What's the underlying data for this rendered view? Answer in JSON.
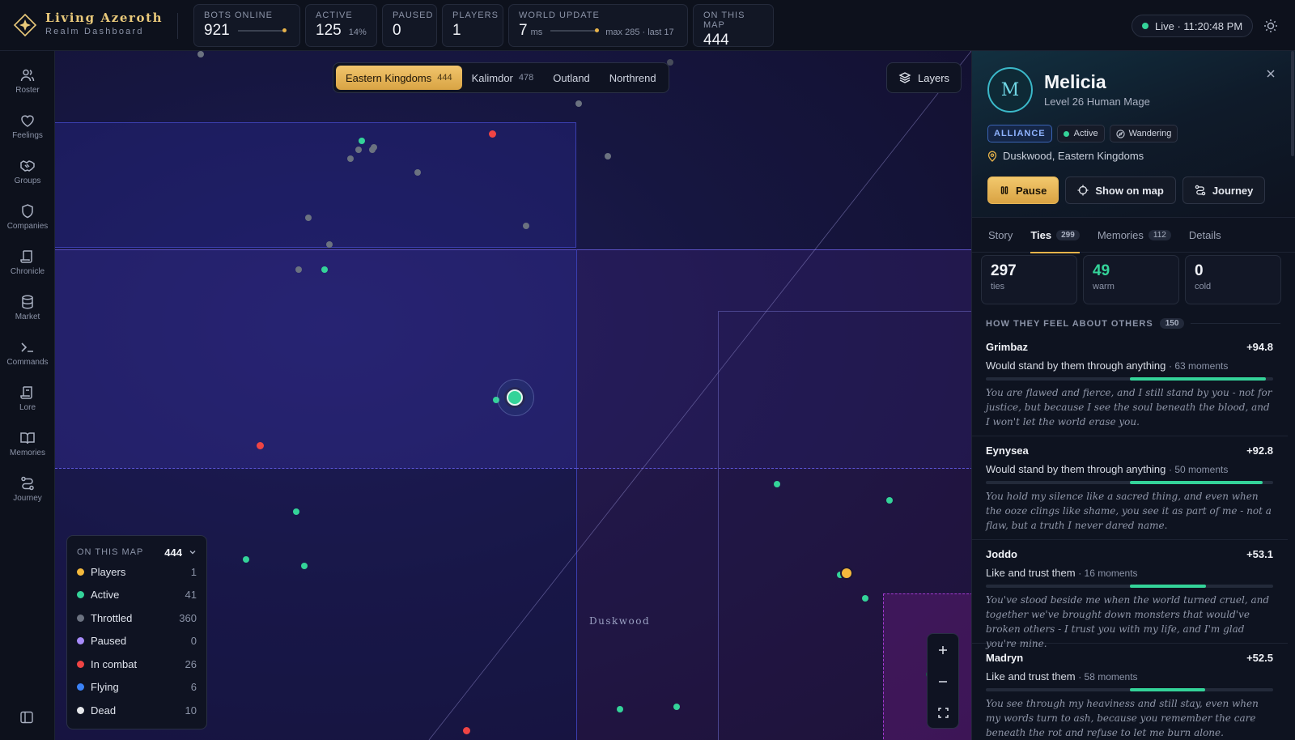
{
  "brand": {
    "name": "Living Azeroth",
    "subtitle": "Realm Dashboard"
  },
  "stats": {
    "bots_online": {
      "label": "BOTS ONLINE",
      "value": "921"
    },
    "active": {
      "label": "ACTIVE",
      "value": "125",
      "percent": "14%"
    },
    "paused": {
      "label": "PAUSED",
      "value": "0"
    },
    "players": {
      "label": "PLAYERS",
      "value": "1"
    },
    "world_update": {
      "label": "WORLD UPDATE",
      "value": "7",
      "unit": "ms",
      "note": "max 285 · last 17"
    },
    "on_this_map": {
      "label": "ON THIS MAP",
      "value": "444"
    }
  },
  "live": {
    "text": "Live · 11:20:48 PM",
    "color": "#34d399"
  },
  "rail": [
    {
      "label": "Roster",
      "icon": "users-icon"
    },
    {
      "label": "Feelings",
      "icon": "heart-icon"
    },
    {
      "label": "Groups",
      "icon": "handshake-icon"
    },
    {
      "label": "Companies",
      "icon": "shield-icon"
    },
    {
      "label": "Chronicle",
      "icon": "scroll-icon"
    },
    {
      "label": "Market",
      "icon": "database-icon"
    },
    {
      "label": "Commands",
      "icon": "terminal-icon"
    },
    {
      "label": "Lore",
      "icon": "book-scroll-icon"
    },
    {
      "label": "Memories",
      "icon": "open-book-icon"
    },
    {
      "label": "Journey",
      "icon": "route-icon"
    }
  ],
  "map": {
    "continent_tabs": [
      {
        "label": "Eastern Kingdoms",
        "count": "444",
        "active": true
      },
      {
        "label": "Kalimdor",
        "count": "478",
        "active": false
      },
      {
        "label": "Outland",
        "count": "",
        "active": false
      },
      {
        "label": "Northrend",
        "count": "",
        "active": false
      }
    ],
    "layers_label": "Layers",
    "zone_label": "Duskwood",
    "legend": {
      "title": "ON THIS MAP",
      "total": "444",
      "rows": [
        {
          "label": "Players",
          "value": "1",
          "color": "#f4b93c"
        },
        {
          "label": "Active",
          "value": "41",
          "color": "#34d399"
        },
        {
          "label": "Throttled",
          "value": "360",
          "color": "#6b7280"
        },
        {
          "label": "Paused",
          "value": "0",
          "color": "#a78bfa"
        },
        {
          "label": "In combat",
          "value": "26",
          "color": "#ef4444"
        },
        {
          "label": "Flying",
          "value": "6",
          "color": "#3b82f6"
        },
        {
          "label": "Dead",
          "value": "10",
          "color": "#e5e7eb"
        }
      ]
    }
  },
  "panel": {
    "avatar_letter": "M",
    "name": "Melicia",
    "subtitle": "Level 26 Human Mage",
    "faction": "ALLIANCE",
    "status": "Active",
    "activity": "Wandering",
    "location": "Duskwood, Eastern Kingdoms",
    "actions": {
      "pause": "Pause",
      "show_on_map": "Show on map",
      "journey": "Journey"
    },
    "tabs": [
      {
        "label": "Story",
        "count": ""
      },
      {
        "label": "Ties",
        "count": "299",
        "active": true
      },
      {
        "label": "Memories",
        "count": "112"
      },
      {
        "label": "Details",
        "count": ""
      }
    ],
    "tiles": [
      {
        "value": "297",
        "label": "ties"
      },
      {
        "value": "49",
        "label": "warm"
      },
      {
        "value": "0",
        "label": "cold"
      }
    ],
    "section_title": "HOW THEY FEEL ABOUT OTHERS",
    "section_count": "150",
    "ties": [
      {
        "name": "Grimbaz",
        "score": "+94.8",
        "level": 94.8,
        "desc": "Would stand by them through anything",
        "moments": "· 63 moments",
        "quote": "You are flawed and fierce, and I still stand by you - not for justice, but because I see the soul beneath the blood, and I won't let the world erase you."
      },
      {
        "name": "Eynysea",
        "score": "+92.8",
        "level": 92.8,
        "desc": "Would stand by them through anything",
        "moments": "· 50 moments",
        "quote": "You hold my silence like a sacred thing, and even when the ooze clings like shame, you see it as part of me - not a flaw, but a truth I never dared name."
      },
      {
        "name": "Joddo",
        "score": "+53.1",
        "level": 53.1,
        "desc": "Like and trust them",
        "moments": "· 16 moments",
        "quote": "You've stood beside me when the world turned cruel, and together we've brought down monsters that would've broken others - I trust you with my life, and I'm glad you're mine."
      },
      {
        "name": "Madryn",
        "score": "+52.5",
        "level": 52.5,
        "desc": "Like and trust them",
        "moments": "· 58 moments",
        "quote": "You see through my heaviness and still stay, even when my words turn to ash, because you remember the care beneath the rot and refuse to let me burn alone."
      }
    ]
  }
}
